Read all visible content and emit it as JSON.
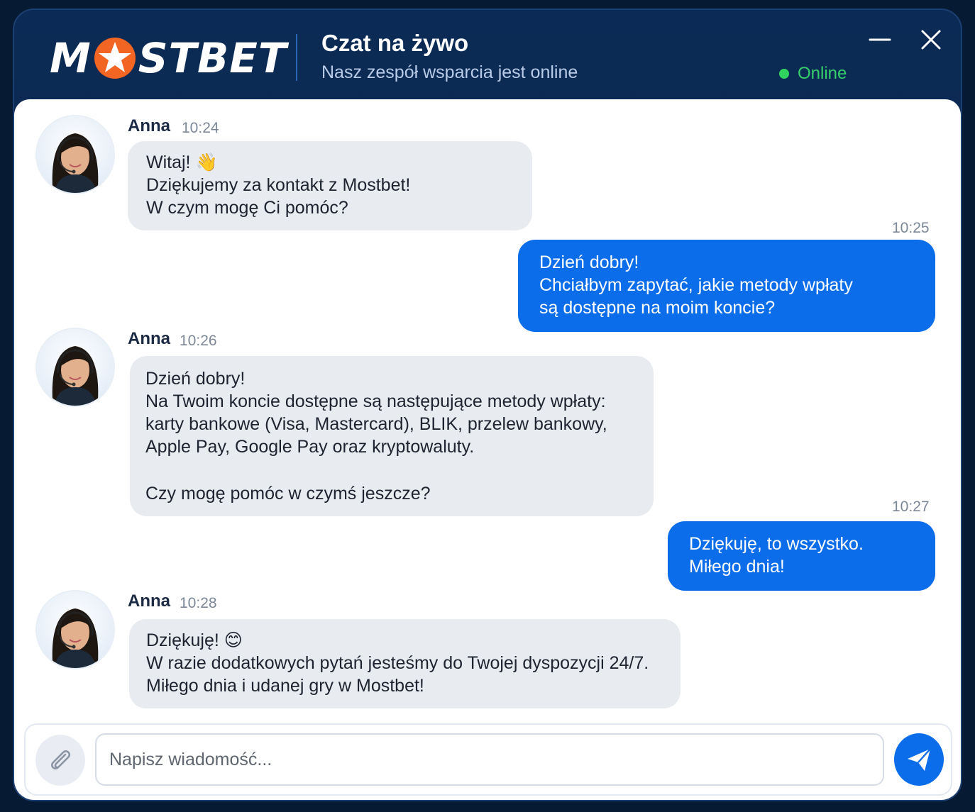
{
  "header": {
    "logo_text_left": "M",
    "logo_text_right": "STBET",
    "title": "Czat na żywo",
    "subtitle": "Nasz zespół wsparcia jest online",
    "status": "Online",
    "minimize_icon": "minimize-icon",
    "close_icon": "close-icon"
  },
  "colors": {
    "brand_orange": "#f26522",
    "header_bg": "#0b2a55",
    "outgoing_bubble": "#0b6dea",
    "incoming_bubble": "#e8ebf0",
    "online": "#2fd55f"
  },
  "messages": [
    {
      "sender": "Anna",
      "time": "10:24",
      "lines": [
        "Witaj! 👋",
        "Dziękujemy za kontakt z Mostbet!",
        "W czym mogę Ci pomóc?"
      ]
    },
    {
      "time": "10:25",
      "lines": [
        "Dzień dobry!",
        "Chciałbym zapytać, jakie metody wpłaty",
        "są dostępne na moim koncie?"
      ]
    },
    {
      "sender": "Anna",
      "time": "10:26",
      "lines": [
        "Dzień dobry!",
        "Na Twoim koncie dostępne są następujące metody wpłaty:",
        "karty bankowe (Visa, Mastercard), BLIK, przelew bankowy,",
        "Apple Pay, Google Pay oraz kryptowaluty.",
        "Czy mogę pomóc w czymś jeszcze?"
      ]
    },
    {
      "time": "10:27",
      "lines": [
        "Dziękuję, to wszystko.",
        "Miłego dnia!"
      ]
    },
    {
      "sender": "Anna",
      "time": "10:28",
      "lines": [
        "Dziękuję! 😊",
        "W razie dodatkowych pytań jesteśmy do Twojej dyspozycji 24/7.",
        "Miłego dnia i udanej gry w Mostbet!"
      ]
    }
  ],
  "composer": {
    "placeholder": "Napisz wiadomość...",
    "attach_icon": "paperclip-icon",
    "send_icon": "send-icon"
  }
}
